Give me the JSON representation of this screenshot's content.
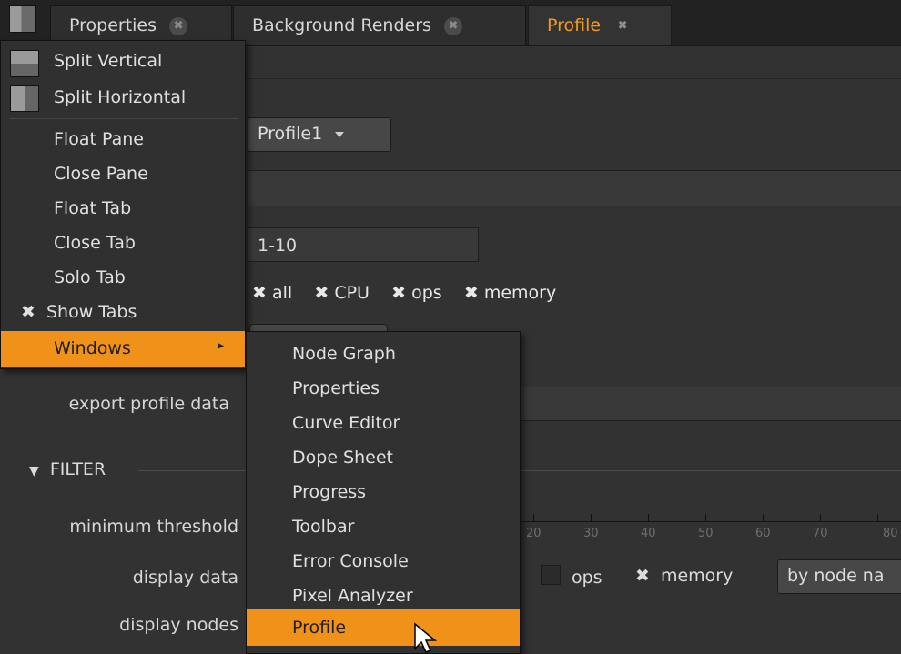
{
  "tabs": [
    {
      "label": "Properties",
      "close_icon": "close-icon"
    },
    {
      "label": "Background Renders",
      "close_icon": "close-icon"
    },
    {
      "label": "Profile",
      "close_icon": "close-icon"
    }
  ],
  "profile": {
    "profile_dropdown": "Profile1",
    "frame_range": "1-10",
    "checks": [
      "all",
      "CPU",
      "ops",
      "memory"
    ],
    "export_label": "export profile data",
    "filter_section": "FILTER",
    "min_threshold_label": "minimum threshold",
    "display_data_label": "display data",
    "display_nodes_label": "display nodes",
    "threshold_ticks": [
      "20",
      "30",
      "40",
      "50",
      "60",
      "70",
      "80"
    ],
    "display_checks": [
      {
        "label": "ops",
        "checked": false
      },
      {
        "label": "memory",
        "checked": true
      }
    ],
    "sort_dropdown": "by node na"
  },
  "context_menu": {
    "items": [
      "Split Vertical",
      "Split Horizontal",
      "Float Pane",
      "Close Pane",
      "Float Tab",
      "Close Tab",
      "Solo Tab",
      "Show Tabs",
      "Windows"
    ],
    "checked_item": "Show Tabs",
    "active_item": "Windows"
  },
  "windows_submenu": {
    "items": [
      "Node Graph",
      "Properties",
      "Curve Editor",
      "Dope Sheet",
      "Progress",
      "Toolbar",
      "Error Console",
      "Pixel Analyzer",
      "Profile"
    ],
    "active_item": "Profile"
  },
  "glyphs": {
    "check": "✖",
    "close": "✖",
    "submenu_arrow": "▸",
    "collapse": "▼"
  },
  "colors": {
    "accent": "#f0921a",
    "active_tab_text": "#f39a1e",
    "panel_bg": "#323232",
    "menu_bg": "#303030"
  }
}
